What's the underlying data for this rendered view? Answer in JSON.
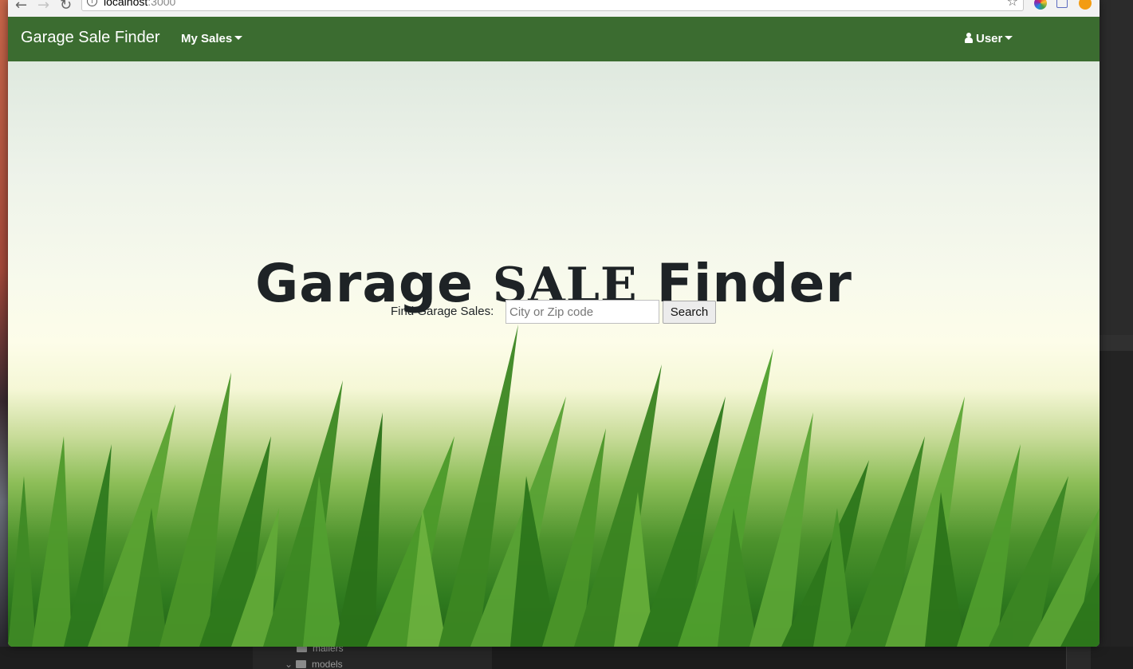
{
  "browser": {
    "url_host": "localhost",
    "url_port": ":3000"
  },
  "navbar": {
    "brand": "Garage Sale Finder",
    "my_sales_label": "My Sales",
    "user_label": "User",
    "background_color": "#3b6c30"
  },
  "hero": {
    "title_part1": "Garage ",
    "title_part2": "SALE",
    "title_part3": " Finder",
    "search_label": "Find Garage Sales:",
    "search_placeholder": "City or Zip code",
    "search_value": "",
    "search_button": "Search"
  },
  "editor_tree": {
    "items": [
      {
        "label": "mailers"
      },
      {
        "label": "models"
      }
    ]
  }
}
